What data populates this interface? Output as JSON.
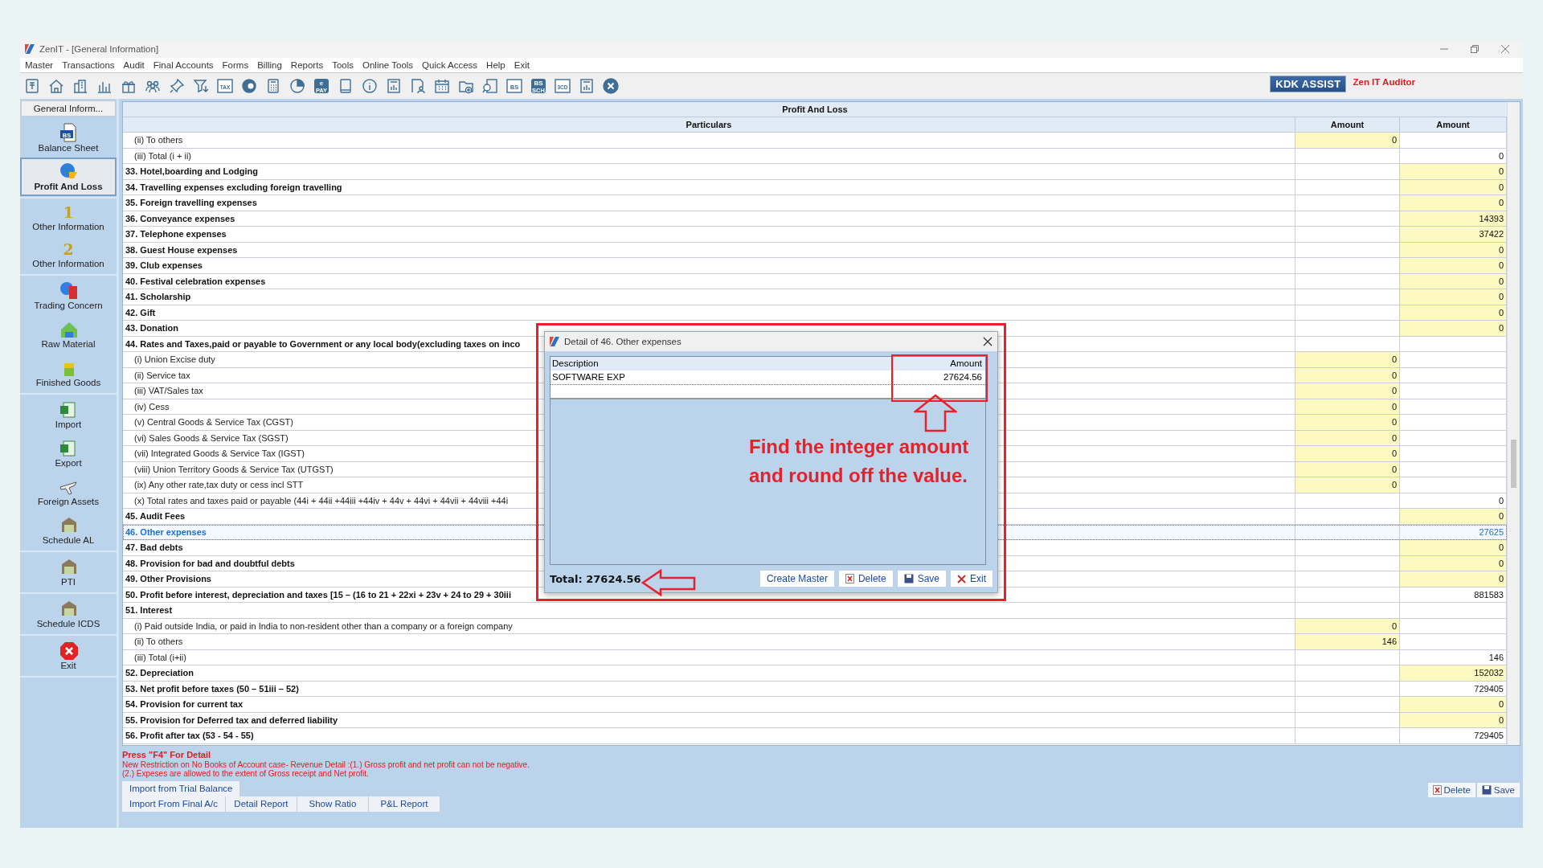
{
  "window": {
    "title": "ZenIT - [General Information]"
  },
  "menu": [
    "Master",
    "Transactions",
    "Audit",
    "Final Accounts",
    "Forms",
    "Billing",
    "Reports",
    "Tools",
    "Online Tools",
    "Quick Access",
    "Help",
    "Exit"
  ],
  "toolbar": [
    {
      "kind": "book"
    },
    {
      "kind": "home"
    },
    {
      "kind": "building"
    },
    {
      "kind": "bars"
    },
    {
      "kind": "gift"
    },
    {
      "kind": "people"
    },
    {
      "kind": "pin"
    },
    {
      "kind": "filter"
    },
    {
      "kind": "label",
      "text": "TAX"
    },
    {
      "kind": "disc"
    },
    {
      "kind": "calculator"
    },
    {
      "kind": "pie"
    },
    {
      "kind": "pay",
      "text": "e",
      "subtext": "PAY"
    },
    {
      "kind": "tablet"
    },
    {
      "kind": "info"
    },
    {
      "kind": "report"
    },
    {
      "kind": "user-doc"
    },
    {
      "kind": "calendar"
    },
    {
      "kind": "folder"
    },
    {
      "kind": "search-doc"
    },
    {
      "kind": "label",
      "text": "BS"
    },
    {
      "kind": "pay",
      "text": "BS",
      "subtext": "SCH"
    },
    {
      "kind": "label",
      "text": "3CD"
    },
    {
      "kind": "report"
    },
    {
      "kind": "close"
    }
  ],
  "brand": {
    "button": "KDK ASSIST",
    "product": "Zen IT Auditor"
  },
  "sidebar": {
    "tab": "General Inform...",
    "groups": [
      [
        {
          "label": "Balance Sheet",
          "icon_text": "BS",
          "selected": false
        },
        {
          "label": "Profit And Loss",
          "selected": true
        }
      ],
      [
        {
          "label": "Other Information",
          "icon_text": "1",
          "selected": false
        },
        {
          "label": "Other Information",
          "icon_text": "2",
          "selected": false
        }
      ],
      [
        {
          "label": "Trading Concern",
          "selected": false
        },
        {
          "label": "Raw Material",
          "selected": false
        },
        {
          "label": "Finished Goods",
          "selected": false
        }
      ],
      [
        {
          "label": "Import",
          "selected": false
        },
        {
          "label": "Export",
          "selected": false
        },
        {
          "label": "Foreign Assets",
          "selected": false
        },
        {
          "label": "Schedule AL",
          "selected": false
        }
      ],
      [
        {
          "label": "PTI",
          "selected": false
        }
      ],
      [
        {
          "label": "Schedule ICDS",
          "selected": false
        }
      ],
      [
        {
          "label": "Exit",
          "selected": false
        }
      ]
    ]
  },
  "table": {
    "title": "Profit And Loss",
    "columns": [
      "Particulars",
      "Amount",
      "Amount"
    ],
    "rows": [
      {
        "kind": "sub",
        "label": "(ii) To others",
        "selected": false,
        "amount_1": {
          "value": "0",
          "editable": true
        }
      },
      {
        "kind": "sub",
        "label": "(iii) Total (i + ii)",
        "selected": false,
        "amount_2": {
          "value": "0",
          "editable": false
        }
      },
      {
        "kind": "item",
        "label": "33. Hotel,boarding and Lodging",
        "selected": false,
        "amount_2": {
          "value": "0",
          "editable": true
        }
      },
      {
        "kind": "item",
        "label": "34. Travelling expenses excluding foreign travelling",
        "selected": false,
        "amount_2": {
          "value": "0",
          "editable": true
        }
      },
      {
        "kind": "item",
        "label": "35. Foreign travelling expenses",
        "selected": false,
        "amount_2": {
          "value": "0",
          "editable": true
        }
      },
      {
        "kind": "item",
        "label": "36. Conveyance expenses",
        "selected": false,
        "amount_2": {
          "value": "14393",
          "editable": true
        }
      },
      {
        "kind": "item",
        "label": "37. Telephone expenses",
        "selected": false,
        "amount_2": {
          "value": "37422",
          "editable": true
        }
      },
      {
        "kind": "item",
        "label": "38. Guest House expenses",
        "selected": false,
        "amount_2": {
          "value": "0",
          "editable": true
        }
      },
      {
        "kind": "item",
        "label": "39. Club expenses",
        "selected": false,
        "amount_2": {
          "value": "0",
          "editable": true
        }
      },
      {
        "kind": "item",
        "label": "40. Festival celebration expenses",
        "selected": false,
        "amount_2": {
          "value": "0",
          "editable": true
        }
      },
      {
        "kind": "item",
        "label": "41. Scholarship",
        "selected": false,
        "amount_2": {
          "value": "0",
          "editable": true
        }
      },
      {
        "kind": "item",
        "label": "42. Gift",
        "selected": false,
        "amount_2": {
          "value": "0",
          "editable": true
        }
      },
      {
        "kind": "item",
        "label": "43. Donation",
        "selected": false,
        "amount_2": {
          "value": "0",
          "editable": true
        }
      },
      {
        "kind": "item",
        "label": "44.  Rates and Taxes,paid or payable to Government or any local body(excluding taxes on inco",
        "selected": false
      },
      {
        "kind": "sub",
        "label": "(i) Union Excise duty",
        "selected": false,
        "amount_1": {
          "value": "0",
          "editable": true
        }
      },
      {
        "kind": "sub",
        "label": "(ii) Service tax",
        "selected": false,
        "amount_1": {
          "value": "0",
          "editable": true
        }
      },
      {
        "kind": "sub",
        "label": "(iii)  VAT/Sales tax",
        "selected": false,
        "amount_1": {
          "value": "0",
          "editable": true
        }
      },
      {
        "kind": "sub",
        "label": "(iv) Cess",
        "selected": false,
        "amount_1": {
          "value": "0",
          "editable": true
        }
      },
      {
        "kind": "sub",
        "label": "(v) Central Goods & Service Tax (CGST)",
        "selected": false,
        "amount_1": {
          "value": "0",
          "editable": true
        }
      },
      {
        "kind": "sub",
        "label": "(vi) Sales Goods & Service Tax (SGST)",
        "selected": false,
        "amount_1": {
          "value": "0",
          "editable": true
        }
      },
      {
        "kind": "sub",
        "label": "(vii) Integrated Goods & Service Tax (IGST)",
        "selected": false,
        "amount_1": {
          "value": "0",
          "editable": true
        }
      },
      {
        "kind": "sub",
        "label": "(viii) Union Territory Goods & Service Tax (UTGST)",
        "selected": false,
        "amount_1": {
          "value": "0",
          "editable": true
        }
      },
      {
        "kind": "sub",
        "label": "(ix)  Any other rate,tax duty or cess incl STT",
        "selected": false,
        "amount_1": {
          "value": "0",
          "editable": true
        }
      },
      {
        "kind": "sub",
        "label": "(x) Total rates and taxes paid or payable (44i + 44ii +44iii +44iv + 44v + 44vi + 44vii + 44viii +44i",
        "selected": false,
        "amount_2": {
          "value": "0",
          "editable": false
        }
      },
      {
        "kind": "item",
        "label": "45. Audit Fees",
        "selected": false,
        "amount_2": {
          "value": "0",
          "editable": true
        }
      },
      {
        "kind": "item",
        "label": "46. Other expenses",
        "selected": true,
        "amount_2": {
          "value": "27625",
          "editable": false
        }
      },
      {
        "kind": "item",
        "label": "47. Bad debts",
        "selected": false,
        "amount_2": {
          "value": "0",
          "editable": true
        }
      },
      {
        "kind": "item",
        "label": "48. Provision for bad and doubtful debts",
        "selected": false,
        "amount_2": {
          "value": "0",
          "editable": true
        }
      },
      {
        "kind": "item",
        "label": "49. Other Provisions",
        "selected": false,
        "amount_2": {
          "value": "0",
          "editable": true
        }
      },
      {
        "kind": "item",
        "label": "50. Profit before interest, depreciation and taxes [15 – (16 to 21 + 22xi + 23v + 24 to 29 + 30iii",
        "selected": false,
        "amount_2": {
          "value": "881583",
          "editable": false
        }
      },
      {
        "kind": "item",
        "label": "51. Interest",
        "selected": false
      },
      {
        "kind": "sub",
        "label": "(i) Paid outside India, or paid in India to non-resident other than a company or a foreign company",
        "selected": false,
        "amount_1": {
          "value": "0",
          "editable": true
        }
      },
      {
        "kind": "sub",
        "label": "(ii) To others",
        "selected": false,
        "amount_1": {
          "value": "146",
          "editable": true
        }
      },
      {
        "kind": "sub",
        "label": "(iii) Total (i+ii)",
        "selected": false,
        "amount_2": {
          "value": "146",
          "editable": false
        }
      },
      {
        "kind": "item",
        "label": "52. Depreciation",
        "selected": false,
        "amount_2": {
          "value": "152032",
          "editable": true
        }
      },
      {
        "kind": "item",
        "label": "53. Net profit before taxes (50 – 51iii – 52)",
        "selected": false,
        "amount_2": {
          "value": "729405",
          "editable": false
        }
      },
      {
        "kind": "item",
        "label": "54. Provision for current tax",
        "selected": false,
        "amount_2": {
          "value": "0",
          "editable": true
        }
      },
      {
        "kind": "item",
        "label": "55. Provision for Deferred tax  and deferred liability",
        "selected": false,
        "amount_2": {
          "value": "0",
          "editable": true
        }
      },
      {
        "kind": "item",
        "label": "56. Profit after tax (53 - 54 - 55)",
        "selected": false,
        "amount_2": {
          "value": "729405",
          "editable": false
        }
      }
    ]
  },
  "notes": {
    "heading": "Press \"F4\" For Detail",
    "lines": [
      "New  Restriction on No Books of Account case- Revenue Detail :(1.) Gross profit and net profit can not be negative.",
      "(2.) Expeses are allowed to the extent of Gross receipt and Net profit."
    ]
  },
  "bottom_tabs": [
    [
      "Import from Trial Balance"
    ],
    [
      "Import From Final A/c",
      "Detail Report",
      "Show Ratio",
      "P&L Report"
    ]
  ],
  "bottom_buttons": [
    "Delete",
    "Save"
  ],
  "dialog": {
    "title": "Detail of 46. Other expenses",
    "columns": [
      "Description",
      "Amount"
    ],
    "rows": [
      {
        "description": "SOFTWARE EXP",
        "amount": "27624.56"
      }
    ],
    "total_label": "Total:",
    "total": "27624.56",
    "buttons": [
      "Create Master",
      "Delete",
      "Save",
      "Exit"
    ]
  },
  "annotation": {
    "text": "Find the integer amount and round off the value."
  }
}
